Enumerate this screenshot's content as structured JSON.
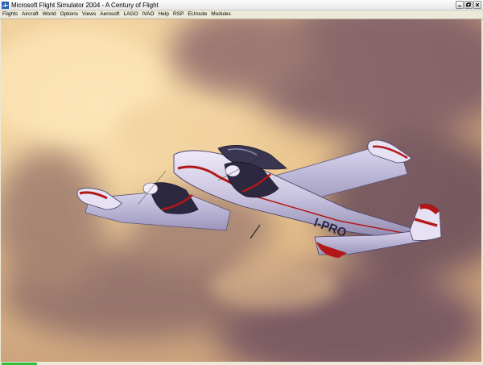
{
  "window": {
    "title": "Microsoft Flight Simulator 2004 - A Century of Flight",
    "app_icon": "fs-plane-icon",
    "controls": {
      "minimize_icon": "minimize-icon",
      "maximize_icon": "maximize-icon",
      "close_icon": "close-icon"
    }
  },
  "menu": {
    "items": [
      {
        "label": "Flights"
      },
      {
        "label": "Aircraft"
      },
      {
        "label": "World"
      },
      {
        "label": "Options"
      },
      {
        "label": "Views"
      },
      {
        "label": "Aerosoft"
      },
      {
        "label": "LAGO"
      },
      {
        "label": "IVAO"
      },
      {
        "label": "Help"
      },
      {
        "label": "RSP"
      },
      {
        "label": "EUroute"
      },
      {
        "label": "Modules"
      }
    ]
  },
  "scene": {
    "registration": "I-PRO",
    "sky_color": "#f0cf9a",
    "cloud_color": "#6e4e5e",
    "aircraft_body_color": "#d8d4ec",
    "stripe_color": "#b31818"
  },
  "status": {
    "indicator_color": "#2fbf3a"
  }
}
